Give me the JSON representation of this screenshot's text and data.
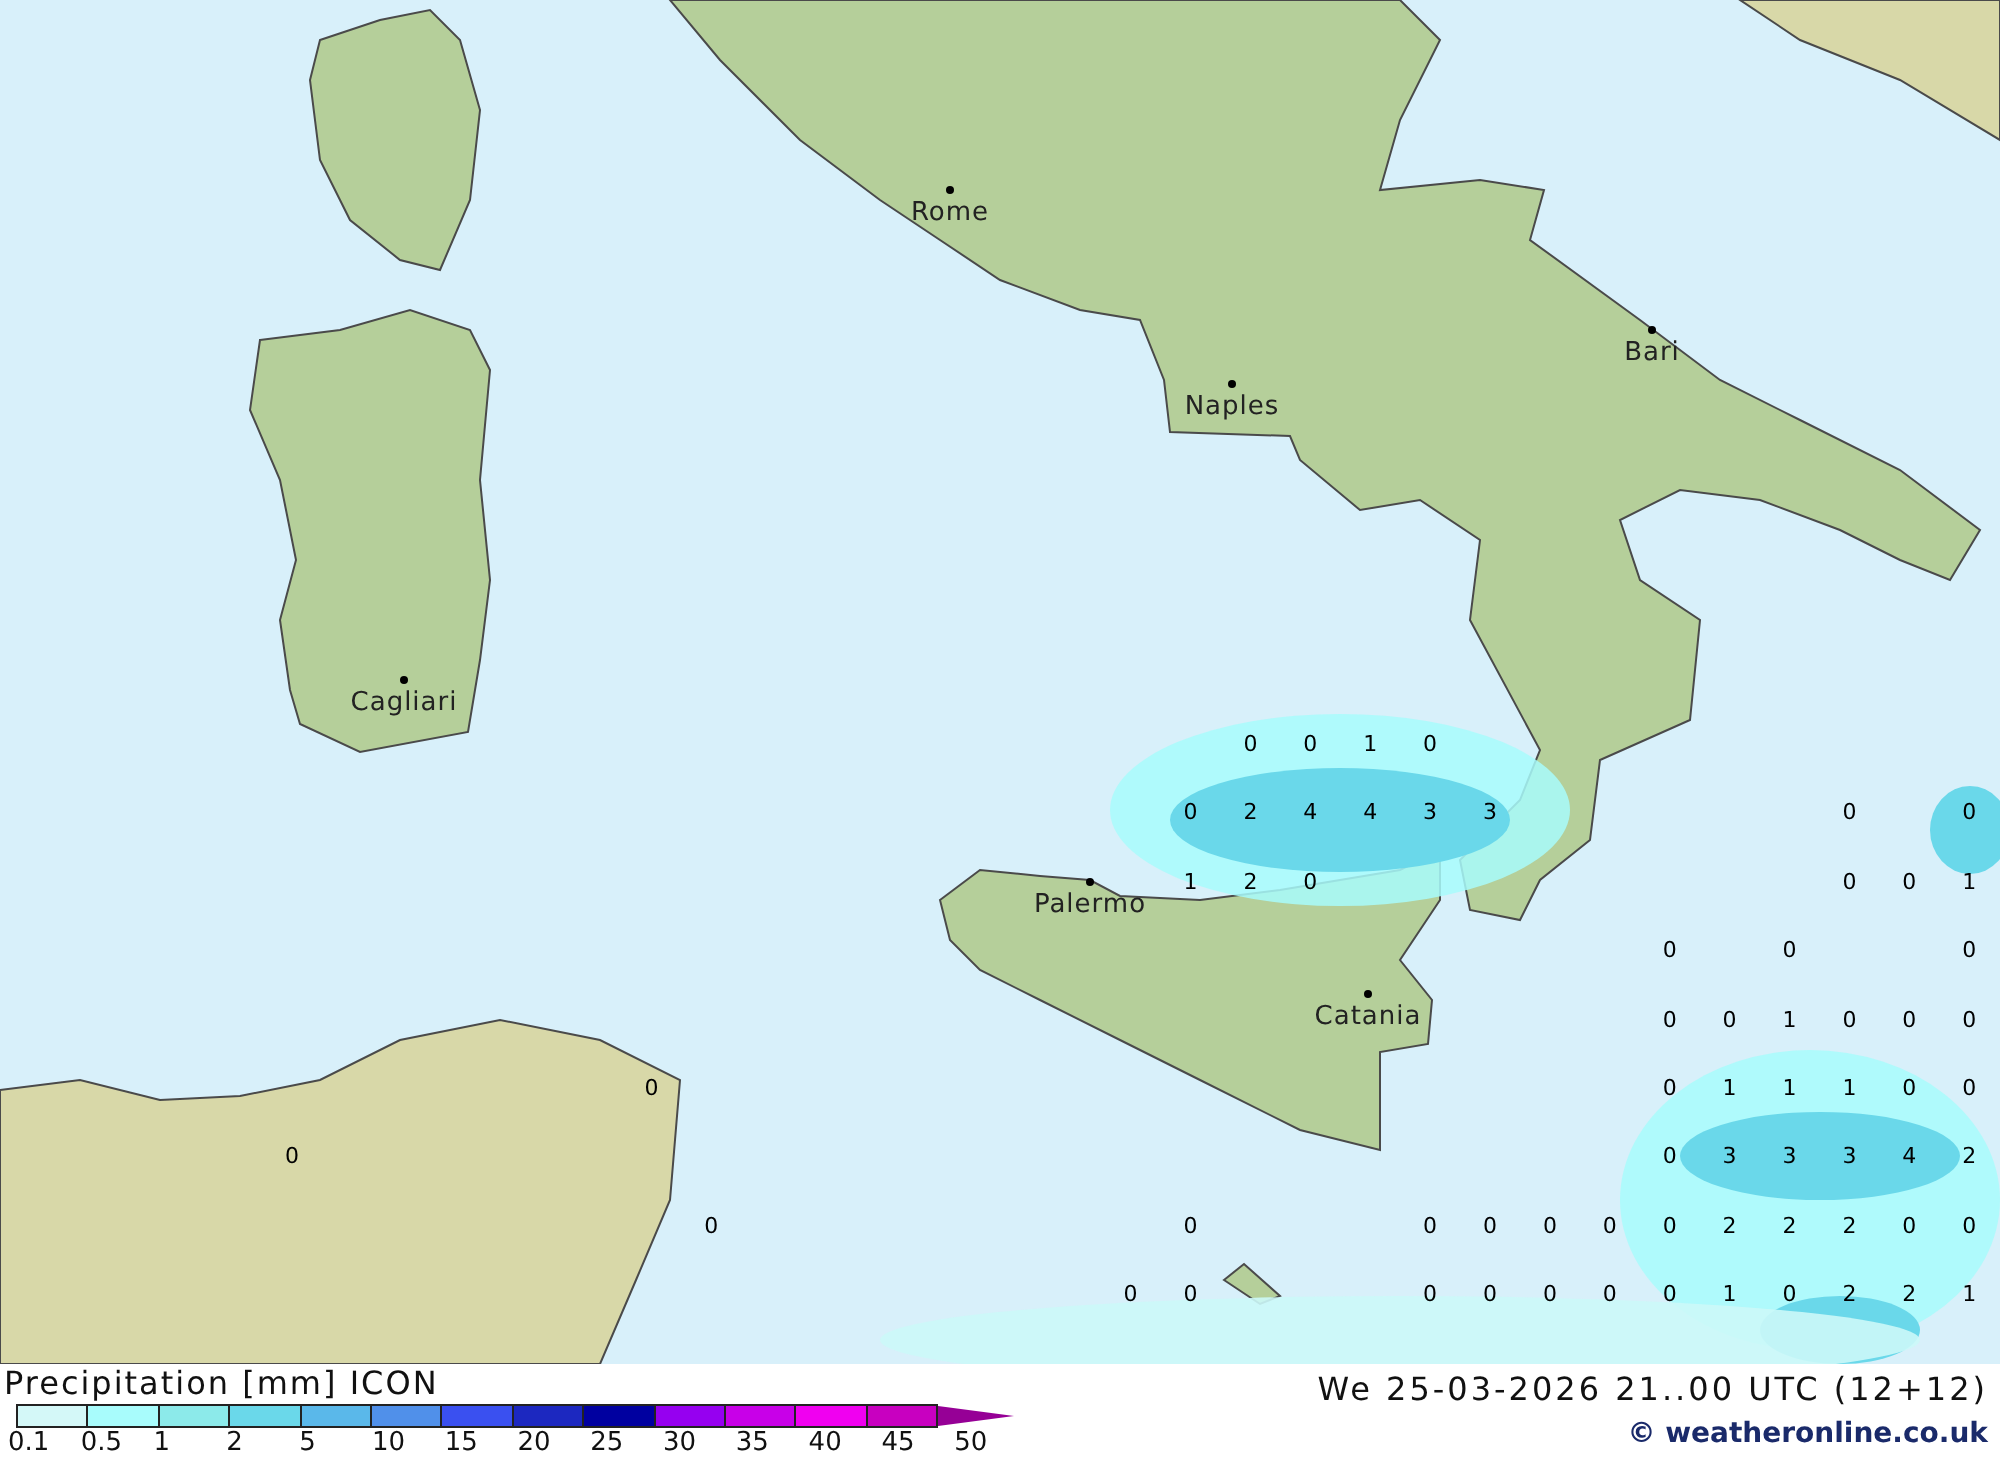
{
  "map": {
    "cities": [
      {
        "name": "Rome"
      },
      {
        "name": "Naples"
      },
      {
        "name": "Bari"
      },
      {
        "name": "Cagliari"
      },
      {
        "name": "Palermo"
      },
      {
        "name": "Catania"
      }
    ],
    "value_rows": [
      [
        null,
        null,
        null,
        null,
        null,
        null,
        null,
        null,
        null,
        null,
        null,
        null,
        null,
        null,
        null,
        null,
        "0",
        "0",
        "1",
        "0",
        null,
        null,
        null,
        null,
        null,
        null,
        null,
        null,
        null
      ],
      [
        null,
        null,
        null,
        null,
        null,
        null,
        null,
        null,
        null,
        null,
        null,
        null,
        null,
        null,
        null,
        "0",
        "2",
        "4",
        "4",
        "3",
        "3",
        null,
        null,
        null,
        null,
        null,
        "0",
        null,
        "0"
      ],
      [
        null,
        null,
        null,
        null,
        null,
        null,
        null,
        null,
        null,
        null,
        null,
        null,
        null,
        null,
        null,
        "1",
        "2",
        "0",
        null,
        null,
        null,
        null,
        null,
        null,
        null,
        null,
        "0",
        "0",
        "1"
      ],
      [
        null,
        null,
        null,
        null,
        null,
        null,
        null,
        null,
        null,
        null,
        null,
        null,
        null,
        null,
        null,
        null,
        null,
        null,
        null,
        null,
        null,
        null,
        null,
        "0",
        null,
        "0",
        null,
        null,
        "0"
      ],
      [
        null,
        null,
        null,
        null,
        null,
        null,
        null,
        null,
        null,
        null,
        null,
        null,
        null,
        null,
        null,
        null,
        null,
        null,
        null,
        null,
        null,
        null,
        null,
        "0",
        "0",
        "1",
        "0",
        "0",
        "0"
      ],
      [
        null,
        null,
        null,
        null,
        null,
        null,
        "0",
        null,
        null,
        null,
        null,
        null,
        null,
        null,
        null,
        null,
        null,
        null,
        null,
        null,
        null,
        null,
        null,
        "0",
        "1",
        "1",
        "1",
        "0",
        "0"
      ],
      [
        "0",
        null,
        null,
        null,
        null,
        null,
        null,
        null,
        null,
        null,
        null,
        null,
        null,
        null,
        null,
        null,
        null,
        null,
        null,
        null,
        null,
        null,
        null,
        "0",
        "3",
        "3",
        "3",
        "4",
        "2"
      ],
      [
        null,
        null,
        null,
        null,
        null,
        null,
        null,
        "0",
        null,
        null,
        null,
        null,
        null,
        null,
        null,
        "0",
        null,
        null,
        null,
        "0",
        "0",
        "0",
        "0",
        "0",
        "2",
        "2",
        "2",
        "0",
        "0"
      ],
      [
        null,
        null,
        null,
        null,
        null,
        null,
        null,
        null,
        null,
        null,
        null,
        null,
        null,
        null,
        "0",
        "0",
        null,
        null,
        null,
        "0",
        "0",
        "0",
        "0",
        "0",
        "1",
        "0",
        "2",
        "2",
        "1"
      ]
    ]
  },
  "legend": {
    "title": "Precipitation [mm] ICON",
    "steps": [
      {
        "label": "0.1",
        "color": "#d4f8f8"
      },
      {
        "label": "0.5",
        "color": "#a8fcfc"
      },
      {
        "label": "1",
        "color": "#8ceaea"
      },
      {
        "label": "2",
        "color": "#6ad8ea"
      },
      {
        "label": "5",
        "color": "#5ab8ea"
      },
      {
        "label": "10",
        "color": "#5090ea"
      },
      {
        "label": "15",
        "color": "#3a50f0"
      },
      {
        "label": "20",
        "color": "#1c28c0"
      },
      {
        "label": "25",
        "color": "#0000a0"
      },
      {
        "label": "30",
        "color": "#9600f0"
      },
      {
        "label": "35",
        "color": "#c800e8"
      },
      {
        "label": "40",
        "color": "#f000f0"
      },
      {
        "label": "45",
        "color": "#c800c0"
      },
      {
        "label": "50",
        "color": "#960096"
      }
    ]
  },
  "valid_time": "We 25-03-2026 21..00 UTC (12+12)",
  "credit": "© weatheronline.co.uk"
}
